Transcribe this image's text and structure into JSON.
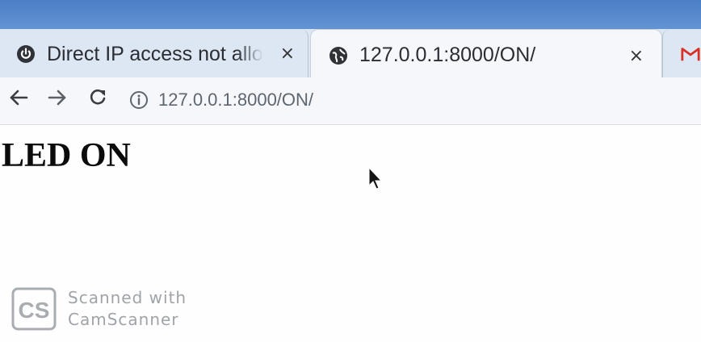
{
  "tabs": [
    {
      "title": "Direct IP access not allo",
      "close": "×",
      "icon": "power-icon",
      "active": false
    },
    {
      "title": "127.0.0.1:8000/ON/",
      "close": "×",
      "icon": "globe-icon",
      "active": true
    },
    {
      "title": "M",
      "icon": "gmail-icon",
      "active": false
    }
  ],
  "toolbar": {
    "back": "back-arrow-icon",
    "forward": "forward-arrow-icon",
    "reload": "reload-icon",
    "info": "info-icon",
    "url": "127.0.0.1:8000/ON/"
  },
  "page": {
    "heading": "LED ON"
  },
  "watermark": {
    "logo": "CS",
    "line1": "Scanned with",
    "line2": "CamScanner"
  },
  "colors": {
    "titlebar": "#5a8dd0",
    "tabstrip": "#dde7f3",
    "active_tab": "#f5f7fa",
    "gmail_red": "#d93025"
  }
}
